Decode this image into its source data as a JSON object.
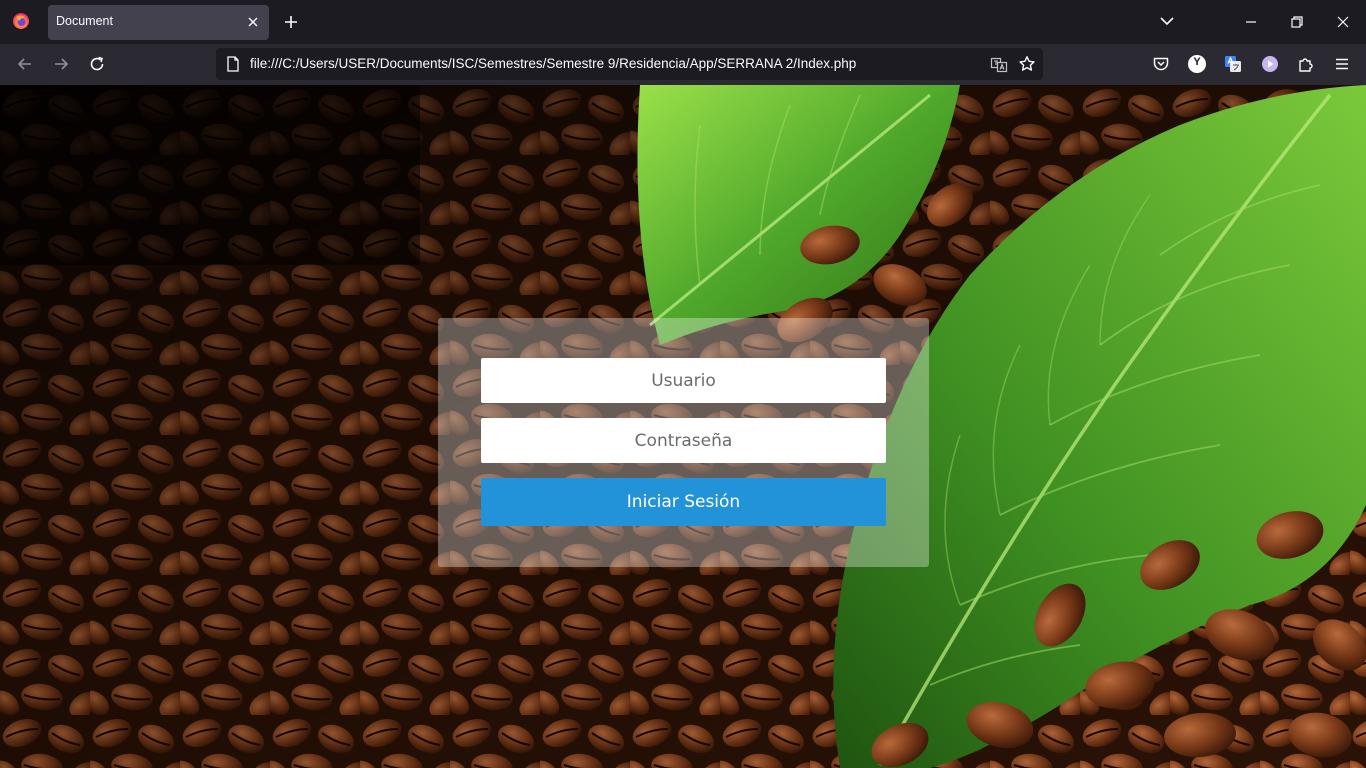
{
  "browser": {
    "tab_title": "Document",
    "url": "file:///C:/Users/USER/Documents/ISC/Semestres/Semestre 9/Residencia/App/SERRANA 2/Index.php",
    "colors": {
      "toolbar": "#2b2a33",
      "tabstrip": "#1c1b22",
      "active_tab": "#42414d"
    },
    "icons": [
      "firefox-icon",
      "close-icon",
      "plus-icon",
      "chevron-down-icon",
      "minimize-icon",
      "restore-icon",
      "window-close-icon",
      "back-icon",
      "forward-icon",
      "reload-icon",
      "page-icon",
      "translate-icon",
      "star-icon",
      "pocket-icon",
      "extension-y-icon",
      "translate-extension-icon",
      "extension-play-icon",
      "extensions-puzzle-icon",
      "menu-icon"
    ],
    "extension_y_label": "Y"
  },
  "login": {
    "username_placeholder": "Usuario",
    "password_placeholder": "Contraseña",
    "submit_label": "Iniciar Sesión",
    "button_color": "#2393d9"
  }
}
